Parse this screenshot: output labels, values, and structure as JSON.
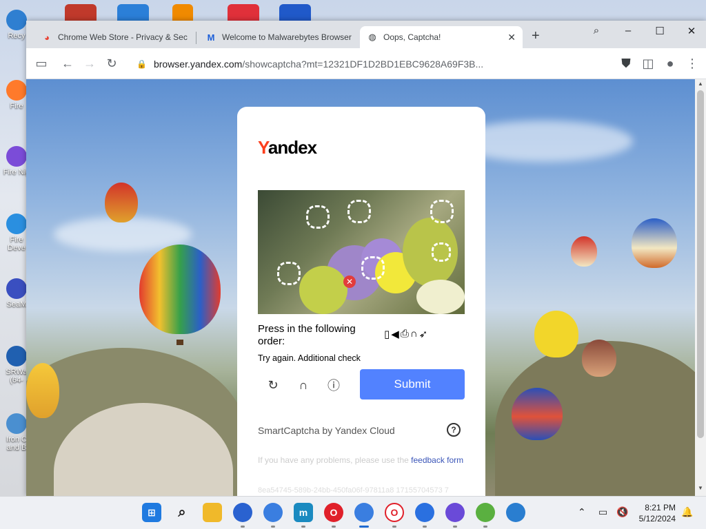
{
  "desktop": {
    "icons": [
      {
        "label": "Recy",
        "color": "#2f7fd1"
      },
      {
        "label": "Fire",
        "color": "#ff7a2b"
      },
      {
        "label": "Fire Nig",
        "color": "#7b4cd8"
      },
      {
        "label": "Fire Deve",
        "color": "#2a8fe0"
      },
      {
        "label": "SeaM",
        "color": "#3a4fc0"
      },
      {
        "label": "SRWa (64-",
        "color": "#2060b0"
      },
      {
        "label": "Iron C and B",
        "color": "#4a8fd0"
      }
    ]
  },
  "browser": {
    "tabs": [
      {
        "title": "Chrome Web Store - Privacy & Secu",
        "favicon": "chrome-webstore-icon",
        "active": false
      },
      {
        "title": "Welcome to Malwarebytes Browser",
        "favicon": "malwarebytes-icon",
        "active": false
      },
      {
        "title": "Oops, Captcha!",
        "favicon": "globe-icon",
        "active": true
      }
    ],
    "new_tab": "+",
    "url_host": "browser.yandex.com",
    "url_path": "/showcaptcha?mt=12321DF1D2BD1EBC9628A69F3B..."
  },
  "captcha": {
    "logo_y": "Y",
    "logo_rest": "andex",
    "instruction": "Press in the following order:",
    "order_icons": [
      "phone-icon",
      "megaphone-icon",
      "printer-icon",
      "headphones-icon",
      "rocket-icon"
    ],
    "status": "Try again. Additional check",
    "submit": "Submit",
    "brand": "SmartCaptcha by Yandex Cloud",
    "help": "?",
    "problems_text": "If you have any problems, please use the ",
    "problems_link": "feedback form",
    "hash": "8ea54745-589b-24bb-450fa06f-97811a8 17155704573 7"
  },
  "taskbar": {
    "time": "8:21 PM",
    "date": "5/12/2024"
  }
}
